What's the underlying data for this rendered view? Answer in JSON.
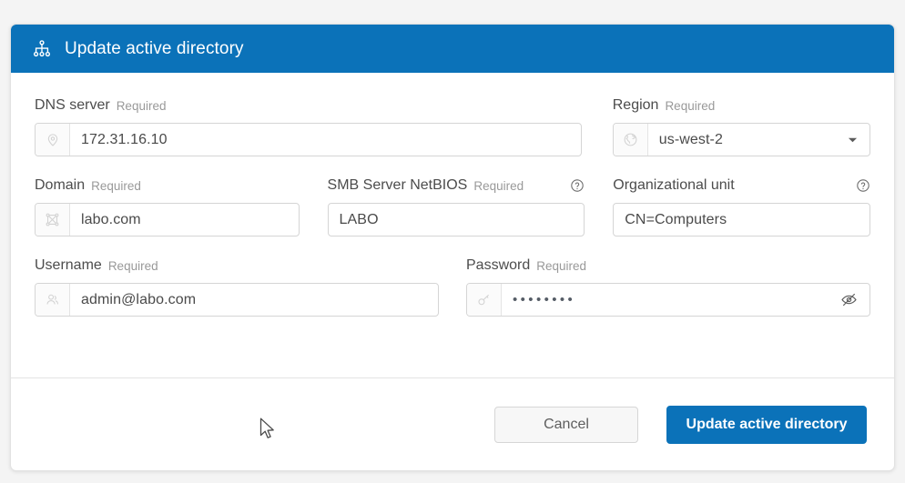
{
  "dialog": {
    "title": "Update active directory",
    "title_icon": "org-hierarchy-icon",
    "accent_color": "#0b72b9",
    "required_text": "Required"
  },
  "fields": {
    "dns_server": {
      "label": "DNS server",
      "required": "Required",
      "value": "172.31.16.10",
      "icon": "location-pin-icon"
    },
    "region": {
      "label": "Region",
      "required": "Required",
      "value": "us-west-2",
      "icon": "globe-icon",
      "caret": "chevron-down-icon"
    },
    "domain": {
      "label": "Domain",
      "required": "Required",
      "value": "labo.com",
      "icon": "network-mesh-icon"
    },
    "smb_netbios": {
      "label": "SMB Server NetBIOS",
      "required": "Required",
      "value": "LABO",
      "help": "help-circle-icon"
    },
    "organizational_unit": {
      "label": "Organizational unit",
      "required": "",
      "value": "CN=Computers",
      "help": "help-circle-icon"
    },
    "username": {
      "label": "Username",
      "required": "Required",
      "value": "admin@labo.com",
      "icon": "user-icon"
    },
    "password": {
      "label": "Password",
      "required": "Required",
      "value": "••••••••",
      "icon": "key-icon",
      "toggle_icon": "eye-slash-icon"
    }
  },
  "footer": {
    "cancel_label": "Cancel",
    "submit_label": "Update active directory"
  }
}
